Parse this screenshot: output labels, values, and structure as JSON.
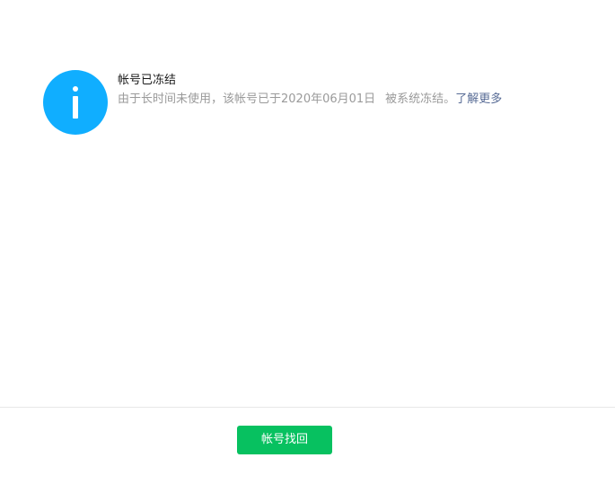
{
  "colors": {
    "info_icon_bg": "#10aeff",
    "primary_button": "#07c160",
    "link": "#576b95",
    "description": "#9a9a9a"
  },
  "notice": {
    "icon": "info-circle-icon",
    "title": "帐号已冻结",
    "description_part1": "由于长时间未使用，该帐号已于2020年06月01日",
    "description_part2": "被系统冻结。",
    "learn_more_label": "了解更多"
  },
  "footer": {
    "recover_button_label": "帐号找回"
  }
}
